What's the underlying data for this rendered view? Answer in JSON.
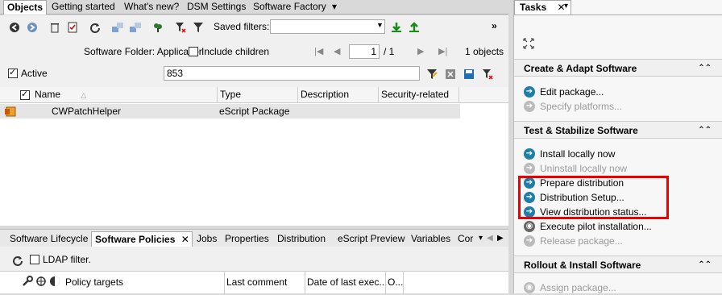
{
  "tabs": [
    {
      "label": "Objects",
      "active": true
    },
    {
      "label": "Getting started"
    },
    {
      "label": "What's new?"
    },
    {
      "label": "DSM Settings"
    },
    {
      "label": "Software Factory"
    }
  ],
  "tab_overflow": "▾",
  "toolbar": {
    "saved_filters_label": "Saved filters:",
    "saved_filters_value": "",
    "more": "»"
  },
  "folder_line": {
    "label": "Software Folder: Applicatior",
    "include_children": "Include children",
    "page_current": "1",
    "page_total": "/ 1",
    "object_count": "1 objects"
  },
  "filter": {
    "active_label": "Active",
    "search_value": "853"
  },
  "grid": {
    "columns": [
      "Name",
      "Type",
      "Description",
      "Security-related"
    ],
    "rows": [
      {
        "name": "CWPatchHelper",
        "type": "eScript Package",
        "description": "",
        "security": ""
      }
    ]
  },
  "bottom_tabs": [
    {
      "label": "Software Lifecycle"
    },
    {
      "label": "Software Policies",
      "active": true
    },
    {
      "label": "Jobs"
    },
    {
      "label": "Properties"
    },
    {
      "label": "Distribution"
    },
    {
      "label": "eScript Preview"
    },
    {
      "label": "Variables"
    },
    {
      "label": "Cor"
    }
  ],
  "lower": {
    "ldap_filter": "LDAP filter.",
    "columns": [
      "Policy targets",
      "Last comment",
      "Date of last exec...",
      "O..."
    ]
  },
  "tasks": {
    "title": "Tasks",
    "pin": "✕",
    "sections": [
      {
        "title": "Create & Adapt Software",
        "items": [
          {
            "label": "Edit package...",
            "enabled": true
          },
          {
            "label": "Specify platforms...",
            "enabled": false
          }
        ]
      },
      {
        "title": "Test & Stabilize Software",
        "items": [
          {
            "label": "Install locally now",
            "enabled": true
          },
          {
            "label": "Uninstall locally now",
            "enabled": false
          },
          {
            "label": "Prepare distribution",
            "enabled": true
          },
          {
            "label": "Distribution Setup...",
            "enabled": true
          },
          {
            "label": "View distribution status...",
            "enabled": true
          },
          {
            "label": "Execute pilot installation...",
            "enabled": true
          },
          {
            "label": "Release package...",
            "enabled": false
          }
        ]
      },
      {
        "title": "Rollout & Install Software",
        "items": [
          {
            "label": "Assign package...",
            "enabled": false
          }
        ]
      }
    ]
  },
  "colors": {
    "accent": "#1f7ea8",
    "highlight": "#e00000"
  }
}
